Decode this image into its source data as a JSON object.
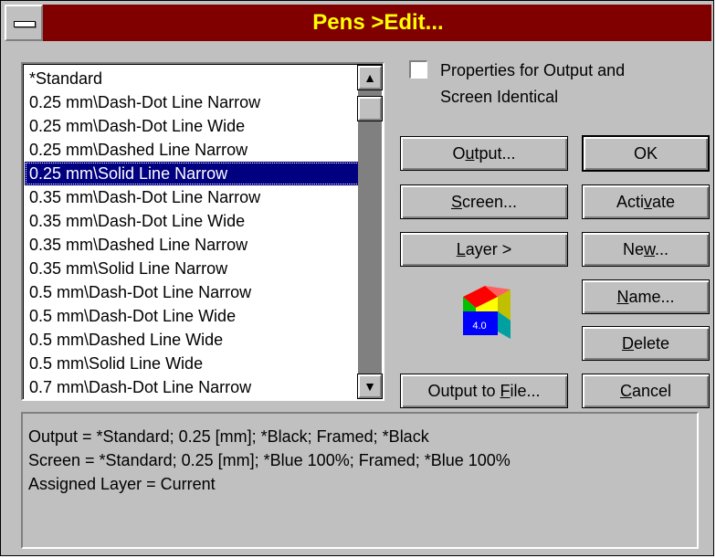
{
  "window": {
    "title": "Pens >Edit..."
  },
  "list": {
    "items": [
      "*Standard",
      "0.25 mm\\Dash-Dot Line Narrow",
      "0.25 mm\\Dash-Dot Line Wide",
      "0.25 mm\\Dashed Line Narrow",
      "0.25 mm\\Solid Line Narrow",
      "0.35 mm\\Dash-Dot Line Narrow",
      "0.35 mm\\Dash-Dot Line Wide",
      "0.35 mm\\Dashed Line Narrow",
      "0.35 mm\\Solid Line Narrow",
      "0.5 mm\\Dash-Dot Line Narrow",
      "0.5 mm\\Dash-Dot Line Wide",
      "0.5 mm\\Dashed Line Wide",
      "0.5 mm\\Solid Line Wide",
      "0.7 mm\\Dash-Dot Line Narrow"
    ],
    "selected_index": 4
  },
  "checkbox": {
    "label_line1": "Properties for Output and",
    "label_line2": "Screen Identical",
    "checked": false
  },
  "buttons": {
    "output_pre": "O",
    "output_ul": "u",
    "output_post": "tput...",
    "screen_ul": "S",
    "screen_post": "creen...",
    "layer_ul": "L",
    "layer_post": "ayer >",
    "output_file_pre": "Output to ",
    "output_file_ul": "F",
    "output_file_post": "ile...",
    "ok": "OK",
    "activate_pre": "Acti",
    "activate_ul": "v",
    "activate_post": "ate",
    "new_pre": "Ne",
    "new_ul": "w",
    "new_post": "...",
    "name_ul": "N",
    "name_post": "ame...",
    "delete_ul": "D",
    "delete_post": "elete",
    "cancel_ul": "C",
    "cancel_post": "ancel"
  },
  "logo": {
    "version": "4.0"
  },
  "info": {
    "lines": [
      "Output = *Standard; 0.25 [mm]; *Black; Framed; *Black",
      "Screen = *Standard; 0.25 [mm]; *Blue 100%; Framed; *Blue 100%",
      "Assigned Layer = Current"
    ]
  },
  "colors": {
    "titlebar": "#800000",
    "title_text": "#ffff00",
    "selection": "#000080",
    "face": "#c0c0c0"
  }
}
